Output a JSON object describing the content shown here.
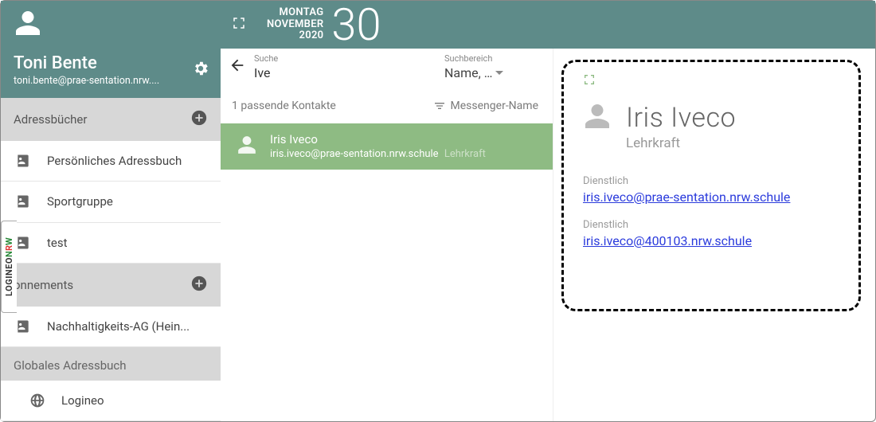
{
  "user": {
    "name": "Toni Bente",
    "email": "toni.bente@prae-sentation.nrw...."
  },
  "sidebar": {
    "adressbuecher_label": "Adressbücher",
    "books": [
      {
        "label": "Persönliches Adressbuch"
      },
      {
        "label": "Sportgruppe"
      },
      {
        "label": "test"
      }
    ],
    "abonnements_label": "onnements",
    "abos": [
      {
        "label": "Nachhaltigkeits-AG (Hein..."
      }
    ],
    "global_label": "Globales Adressbuch",
    "global_items": [
      {
        "label": "Logineo"
      }
    ]
  },
  "topbar": {
    "weekday": "MONTAG",
    "month": "NOVEMBER",
    "year": "2020",
    "day": "30"
  },
  "search": {
    "suche_label": "Suche",
    "suche_value": "Ive",
    "bereich_label": "Suchbereich",
    "bereich_value": "Name, …",
    "result_count": "1 passende Kontakte",
    "sort_label": "Messenger-Name"
  },
  "result": {
    "name": "Iris Iveco",
    "email": "iris.iveco@prae-sentation.nrw.schule",
    "role": "Lehrkraft"
  },
  "detail": {
    "name": "Iris Iveco",
    "role": "Lehrkraft",
    "entries": [
      {
        "label": "Dienstlich",
        "value": "iris.iveco@prae-sentation.nrw.schule"
      },
      {
        "label": "Dienstlich",
        "value": "iris.iveco@400103.nrw.schule"
      }
    ]
  },
  "side_tab": {
    "p1": "LOGINEO",
    "p2": "N",
    "p3": "R",
    "p4": "W"
  }
}
